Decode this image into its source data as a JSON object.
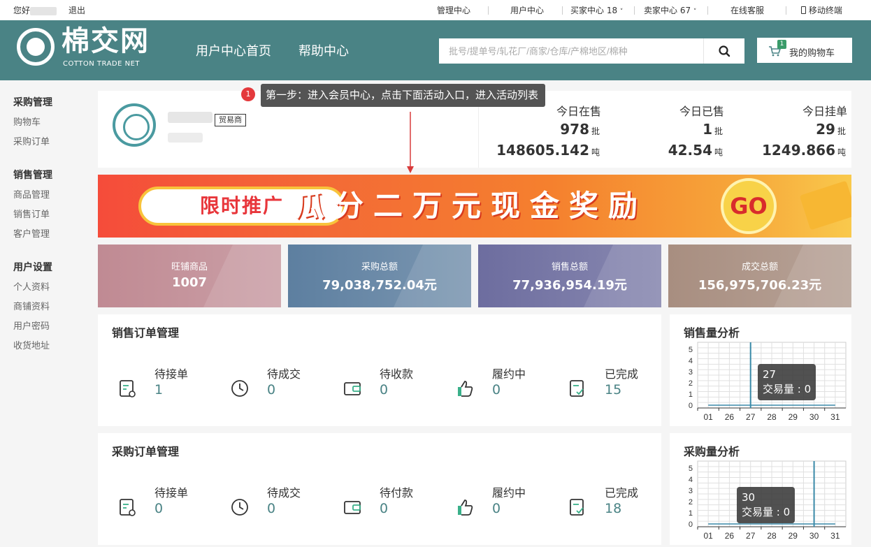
{
  "topbar": {
    "greeting": "您好",
    "logout": "退出",
    "links": [
      "管理中心",
      "用户中心",
      "买家中心 18",
      "卖家中心 67",
      "在线客服",
      "移动终端"
    ]
  },
  "header": {
    "logo_name": "棉交网",
    "logo_sub": "COTTON TRADE NET",
    "nav": [
      "用户中心首页",
      "帮助中心"
    ],
    "search_placeholder": "批号/提单号/轧花厂/商家/仓库/产棉地区/棉种",
    "cart_label": "我的购物车",
    "cart_count": "1"
  },
  "sidebar": {
    "sections": [
      {
        "title": "采购管理",
        "items": [
          "购物车",
          "采购订单"
        ]
      },
      {
        "title": "销售管理",
        "items": [
          "商品管理",
          "销售订单",
          "客户管理"
        ]
      },
      {
        "title": "用户设置",
        "items": [
          "个人资料",
          "商铺资料",
          "用户密码",
          "收货地址"
        ]
      }
    ]
  },
  "tooltip": {
    "badge": "1",
    "text": "第一步：进入会员中心，点击下面活动入口，进入活动列表"
  },
  "profile": {
    "badge": "贸易商"
  },
  "stats": [
    {
      "label": "今日在售",
      "count": "978",
      "count_unit": "批",
      "weight": "148605.142",
      "weight_unit": "吨"
    },
    {
      "label": "今日已售",
      "count": "1",
      "count_unit": "批",
      "weight": "42.54",
      "weight_unit": "吨"
    },
    {
      "label": "今日挂单",
      "count": "29",
      "count_unit": "批",
      "weight": "1249.866",
      "weight_unit": "吨"
    }
  ],
  "banner": {
    "tag": "限时推广",
    "title": "瓜分二万元现金奖励",
    "go": "GO"
  },
  "metrics": [
    {
      "label": "旺铺商品",
      "value": "1007",
      "color": "#c08a93"
    },
    {
      "label": "采购总额",
      "value": "79,038,752.04元",
      "color": "#5d7fa0"
    },
    {
      "label": "销售总额",
      "value": "77,936,954.19元",
      "color": "#6d6d9f"
    },
    {
      "label": "成交总额",
      "value": "156,975,706.23元",
      "color": "#a88e80"
    }
  ],
  "sales_orders": {
    "title": "销售订单管理",
    "items": [
      {
        "label": "待接单",
        "value": "1",
        "icon": "order-icon"
      },
      {
        "label": "待成交",
        "value": "0",
        "icon": "clock-icon"
      },
      {
        "label": "待收款",
        "value": "0",
        "icon": "wallet-icon"
      },
      {
        "label": "履约中",
        "value": "0",
        "icon": "thumbs-up-icon"
      },
      {
        "label": "已完成",
        "value": "15",
        "icon": "check-doc-icon"
      }
    ]
  },
  "purchase_orders": {
    "title": "采购订单管理",
    "items": [
      {
        "label": "待接单",
        "value": "0",
        "icon": "order-icon"
      },
      {
        "label": "待成交",
        "value": "0",
        "icon": "clock-icon"
      },
      {
        "label": "待付款",
        "value": "0",
        "icon": "wallet-icon"
      },
      {
        "label": "履约中",
        "value": "0",
        "icon": "thumbs-up-icon"
      },
      {
        "label": "已完成",
        "value": "18",
        "icon": "check-doc-icon"
      }
    ]
  },
  "chart_data": [
    {
      "type": "line",
      "title": "销售量分析",
      "x": [
        "01",
        "26",
        "27",
        "28",
        "29",
        "30",
        "31"
      ],
      "yticks": [
        "0",
        "1",
        "2",
        "3",
        "4",
        "5"
      ],
      "ylim": [
        0,
        5
      ],
      "grid": true,
      "highlight": "27",
      "tooltip_date": "27",
      "tooltip_text": "交易量 : 0",
      "series": [
        {
          "values": [
            0,
            0,
            0,
            0,
            0,
            0,
            0
          ]
        }
      ],
      "color": "#3a8aa8"
    },
    {
      "type": "line",
      "title": "采购量分析",
      "x": [
        "01",
        "26",
        "27",
        "28",
        "29",
        "30",
        "31"
      ],
      "yticks": [
        "0",
        "1",
        "2",
        "3",
        "4",
        "5"
      ],
      "ylim": [
        0,
        5
      ],
      "grid": true,
      "highlight": "30",
      "tooltip_date": "30",
      "tooltip_text": "交易量 : 0",
      "series": [
        {
          "values": [
            0,
            0,
            0,
            0,
            0,
            0,
            0
          ]
        }
      ],
      "color": "#3a8aa8"
    }
  ]
}
